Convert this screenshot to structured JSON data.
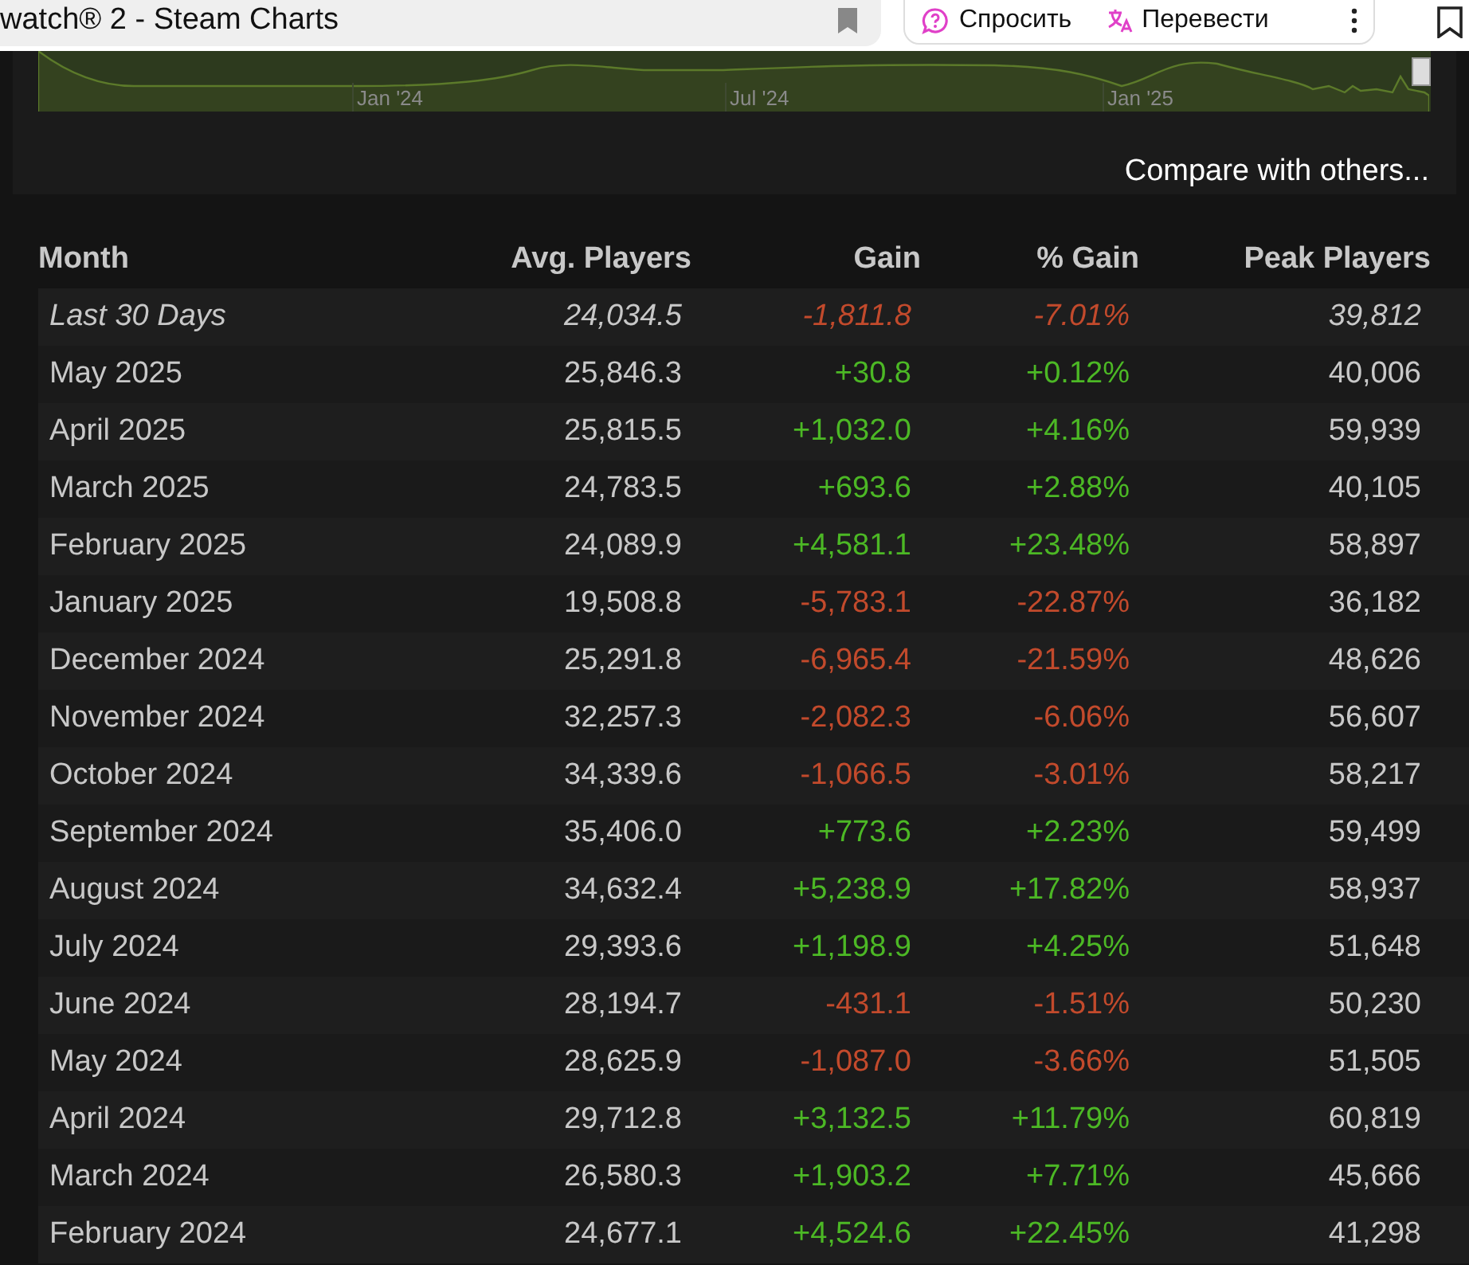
{
  "browser": {
    "tab_title": "watch® 2 - Steam Charts",
    "buttons": [
      {
        "label": "Спросить",
        "kind": "ask"
      },
      {
        "label": "Перевести",
        "kind": "translate"
      }
    ]
  },
  "chart": {
    "axis_labels": [
      "Jan '24",
      "Jul '24",
      "Jan '25"
    ],
    "link": "Compare with others..."
  },
  "table": {
    "columns": [
      "Month",
      "Avg. Players",
      "Gain",
      "% Gain",
      "Peak Players"
    ],
    "rows": [
      {
        "kind": "summary",
        "color": "#c24a2c",
        "cells": [
          "Last 30 Days",
          "24,034.5",
          "-1,811.8",
          "-7.01%",
          "39,812"
        ]
      },
      {
        "kind": "month",
        "color": "#4cb825",
        "cells": [
          "May 2025",
          "25,846.3",
          "+30.8",
          "+0.12%",
          "40,006"
        ]
      },
      {
        "kind": "month",
        "color": "#4cb825",
        "cells": [
          "April 2025",
          "25,815.5",
          "+1,032.0",
          "+4.16%",
          "59,939"
        ]
      },
      {
        "kind": "month",
        "color": "#4cb825",
        "cells": [
          "March 2025",
          "24,783.5",
          "+693.6",
          "+2.88%",
          "40,105"
        ]
      },
      {
        "kind": "month",
        "color": "#4cb825",
        "cells": [
          "February 2025",
          "24,089.9",
          "+4,581.1",
          "+23.48%",
          "58,897"
        ]
      },
      {
        "kind": "month",
        "color": "#c24a2c",
        "cells": [
          "January 2025",
          "19,508.8",
          "-5,783.1",
          "-22.87%",
          "36,182"
        ]
      },
      {
        "kind": "month",
        "color": "#c24a2c",
        "cells": [
          "December 2024",
          "25,291.8",
          "-6,965.4",
          "-21.59%",
          "48,626"
        ]
      },
      {
        "kind": "month",
        "color": "#c24a2c",
        "cells": [
          "November 2024",
          "32,257.3",
          "-2,082.3",
          "-6.06%",
          "56,607"
        ]
      },
      {
        "kind": "month",
        "color": "#c24a2c",
        "cells": [
          "October 2024",
          "34,339.6",
          "-1,066.5",
          "-3.01%",
          "58,217"
        ]
      },
      {
        "kind": "month",
        "color": "#4cb825",
        "cells": [
          "September 2024",
          "35,406.0",
          "+773.6",
          "+2.23%",
          "59,499"
        ]
      },
      {
        "kind": "month",
        "color": "#4cb825",
        "cells": [
          "August 2024",
          "34,632.4",
          "+5,238.9",
          "+17.82%",
          "58,937"
        ]
      },
      {
        "kind": "month",
        "color": "#4cb825",
        "cells": [
          "July 2024",
          "29,393.6",
          "+1,198.9",
          "+4.25%",
          "51,648"
        ]
      },
      {
        "kind": "month",
        "color": "#c24a2c",
        "cells": [
          "June 2024",
          "28,194.7",
          "-431.1",
          "-1.51%",
          "50,230"
        ]
      },
      {
        "kind": "month",
        "color": "#c24a2c",
        "cells": [
          "May 2024",
          "28,625.9",
          "-1,087.0",
          "-3.66%",
          "51,505"
        ]
      },
      {
        "kind": "month",
        "color": "#4cb825",
        "cells": [
          "April 2024",
          "29,712.8",
          "+3,132.5",
          "+11.79%",
          "60,819"
        ]
      },
      {
        "kind": "month",
        "color": "#4cb825",
        "cells": [
          "March 2024",
          "26,580.3",
          "+1,903.2",
          "+7.71%",
          "45,666"
        ]
      },
      {
        "kind": "month",
        "color": "#4cb825",
        "cells": [
          "February 2024",
          "24,677.1",
          "+4,524.6",
          "+22.45%",
          "41,298"
        ]
      }
    ]
  }
}
